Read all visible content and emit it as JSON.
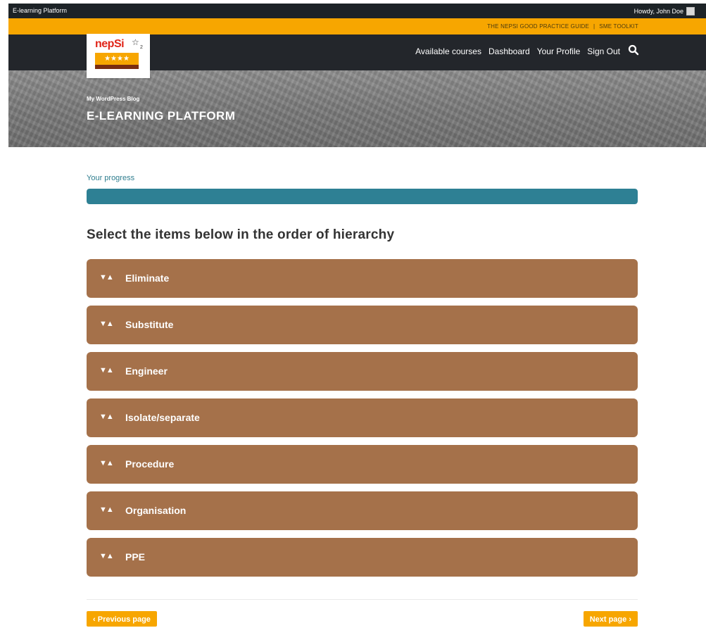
{
  "admin_bar": {
    "site_name": "E-learning Platform",
    "greeting": "Howdy, John Doe"
  },
  "top_links": {
    "guide": "THE NEPSI GOOD PRACTICE GUIDE",
    "separator": "|",
    "toolkit": "SME TOOLKIT"
  },
  "logo": {
    "text": "nepSi",
    "subscript": "2",
    "stars": "★★★★"
  },
  "nav": {
    "items": [
      "Available courses",
      "Dashboard",
      "Your Profile",
      "Sign Out"
    ]
  },
  "hero": {
    "blog_name": "My WordPress Blog",
    "title": "E-LEARNING PLATFORM"
  },
  "progress": {
    "label": "Your progress",
    "value_percent": 100,
    "color": "#2e8094"
  },
  "question": {
    "text": "Select the items below in the order of hierarchy"
  },
  "sortable_items": [
    {
      "arrows": "▼▲",
      "label": "Eliminate"
    },
    {
      "arrows": "▼▲",
      "label": "Substitute"
    },
    {
      "arrows": "▼▲",
      "label": "Engineer"
    },
    {
      "arrows": "▼▲",
      "label": "Isolate/separate"
    },
    {
      "arrows": "▼▲",
      "label": "Procedure"
    },
    {
      "arrows": "▼▲",
      "label": "Organisation"
    },
    {
      "arrows": "▼▲",
      "label": "PPE"
    }
  ],
  "pagination": {
    "prev_label": "Previous page",
    "next_label": "Next page"
  },
  "colors": {
    "accent": "#f7a600",
    "nav_bg": "#23262b",
    "item_bg": "#a5714a"
  }
}
